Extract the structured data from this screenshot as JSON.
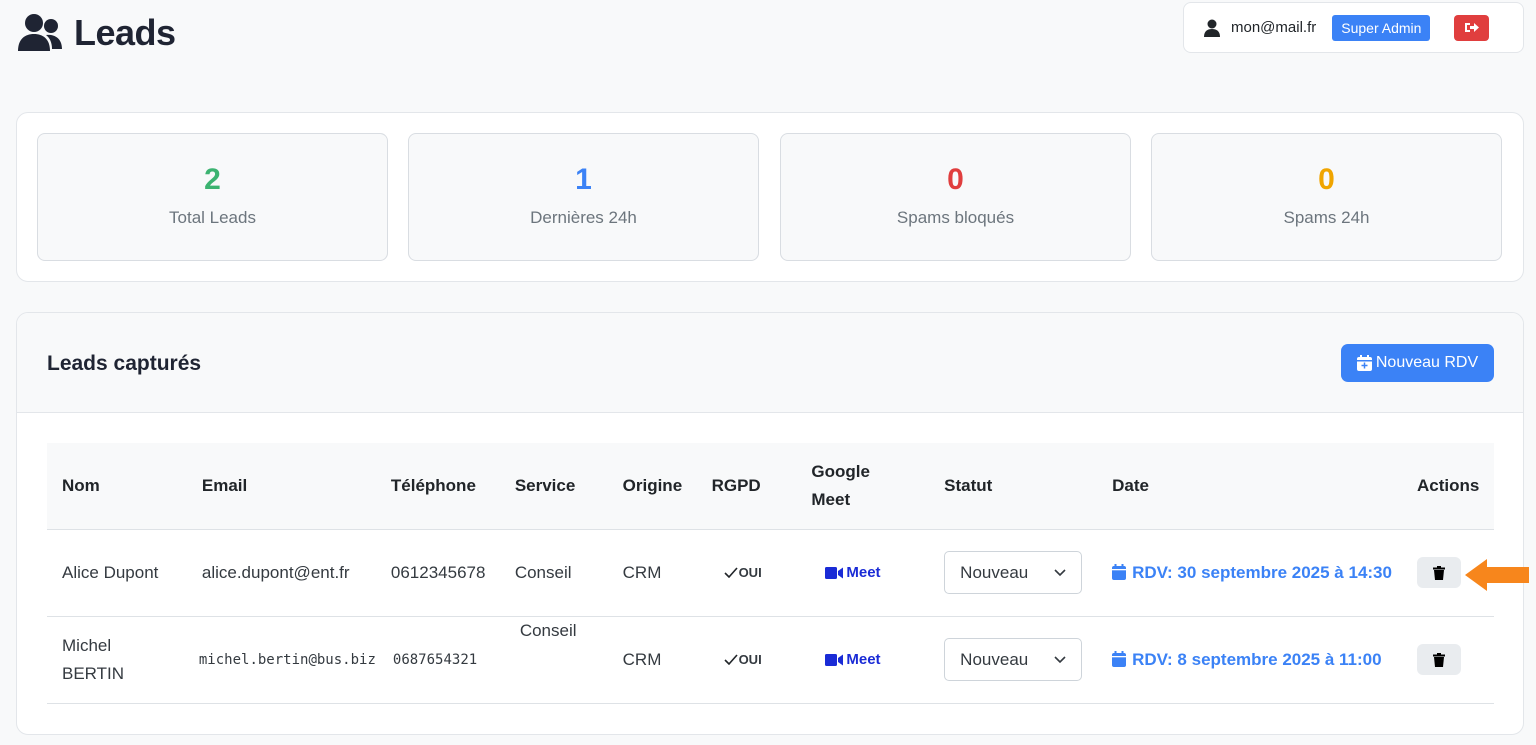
{
  "header": {
    "title": "Leads",
    "user_email": "mon@mail.fr",
    "role_badge": "Super Admin"
  },
  "stats": [
    {
      "value": "2",
      "label": "Total Leads",
      "color": "#3cb371"
    },
    {
      "value": "1",
      "label": "Dernières 24h",
      "color": "#3b82f6"
    },
    {
      "value": "0",
      "label": "Spams bloqués",
      "color": "#e03e3e"
    },
    {
      "value": "0",
      "label": "Spams 24h",
      "color": "#f0a500"
    }
  ],
  "leads": {
    "title": "Leads capturés",
    "new_rdv_label": "Nouveau RDV",
    "columns": [
      "Nom",
      "Email",
      "Téléphone",
      "Service",
      "Origine",
      "RGPD",
      "Google Meet",
      "Statut",
      "Date",
      "Actions"
    ],
    "rows": [
      {
        "name": "Alice Dupont",
        "email": "alice.dupont@ent.fr",
        "phone": "0612345678",
        "service": "Conseil",
        "origin": "CRM",
        "rgpd": "OUI",
        "meet": "Meet",
        "status": "Nouveau",
        "date": "RDV: 30 septembre 2025 à 14:30"
      },
      {
        "name": "Michel BERTIN",
        "email": "michel.bertin@bus.biz",
        "phone": "0687654321",
        "service": "Conseil",
        "origin": "CRM",
        "rgpd": "OUI",
        "meet": "Meet",
        "status": "Nouveau",
        "date": "RDV: 8 septembre 2025 à 11:00"
      }
    ]
  },
  "colors": {
    "primary": "#3b82f6",
    "danger": "#e03e3e",
    "annotation_arrow": "#f7861c"
  }
}
